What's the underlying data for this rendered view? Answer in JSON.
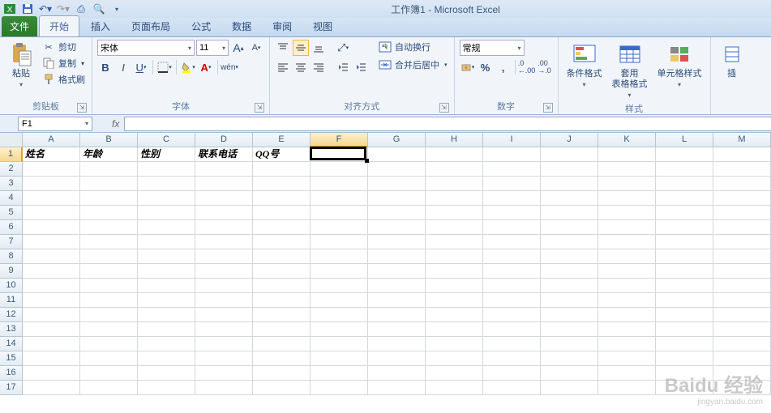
{
  "title": "工作簿1 - Microsoft Excel",
  "tabs": {
    "file": "文件",
    "items": [
      "开始",
      "插入",
      "页面布局",
      "公式",
      "数据",
      "审阅",
      "视图"
    ],
    "active": 0
  },
  "clipboard": {
    "paste": "粘贴",
    "cut": "剪切",
    "copy": "复制",
    "painter": "格式刷",
    "title": "剪贴板"
  },
  "font": {
    "name": "宋体",
    "size": "11",
    "title": "字体"
  },
  "align": {
    "wrap": "自动换行",
    "merge": "合并后居中",
    "title": "对齐方式"
  },
  "number": {
    "fmt": "常规",
    "title": "数字"
  },
  "styles": {
    "cond": "条件格式",
    "table": "套用\n表格格式",
    "cell": "单元格样式",
    "title": "样式"
  },
  "namebox": "F1",
  "columns": [
    "A",
    "B",
    "C",
    "D",
    "E",
    "F",
    "G",
    "H",
    "I",
    "J",
    "K",
    "L",
    "M"
  ],
  "rowcount": 17,
  "activeCol": "F",
  "activeRow": 1,
  "data": {
    "1": {
      "A": "姓名",
      "B": "年龄",
      "C": "性别",
      "D": "联系电话",
      "E": "QQ号"
    }
  },
  "watermark": {
    "main": "Baidu 经验",
    "sub": "jingyan.baidu.com"
  }
}
